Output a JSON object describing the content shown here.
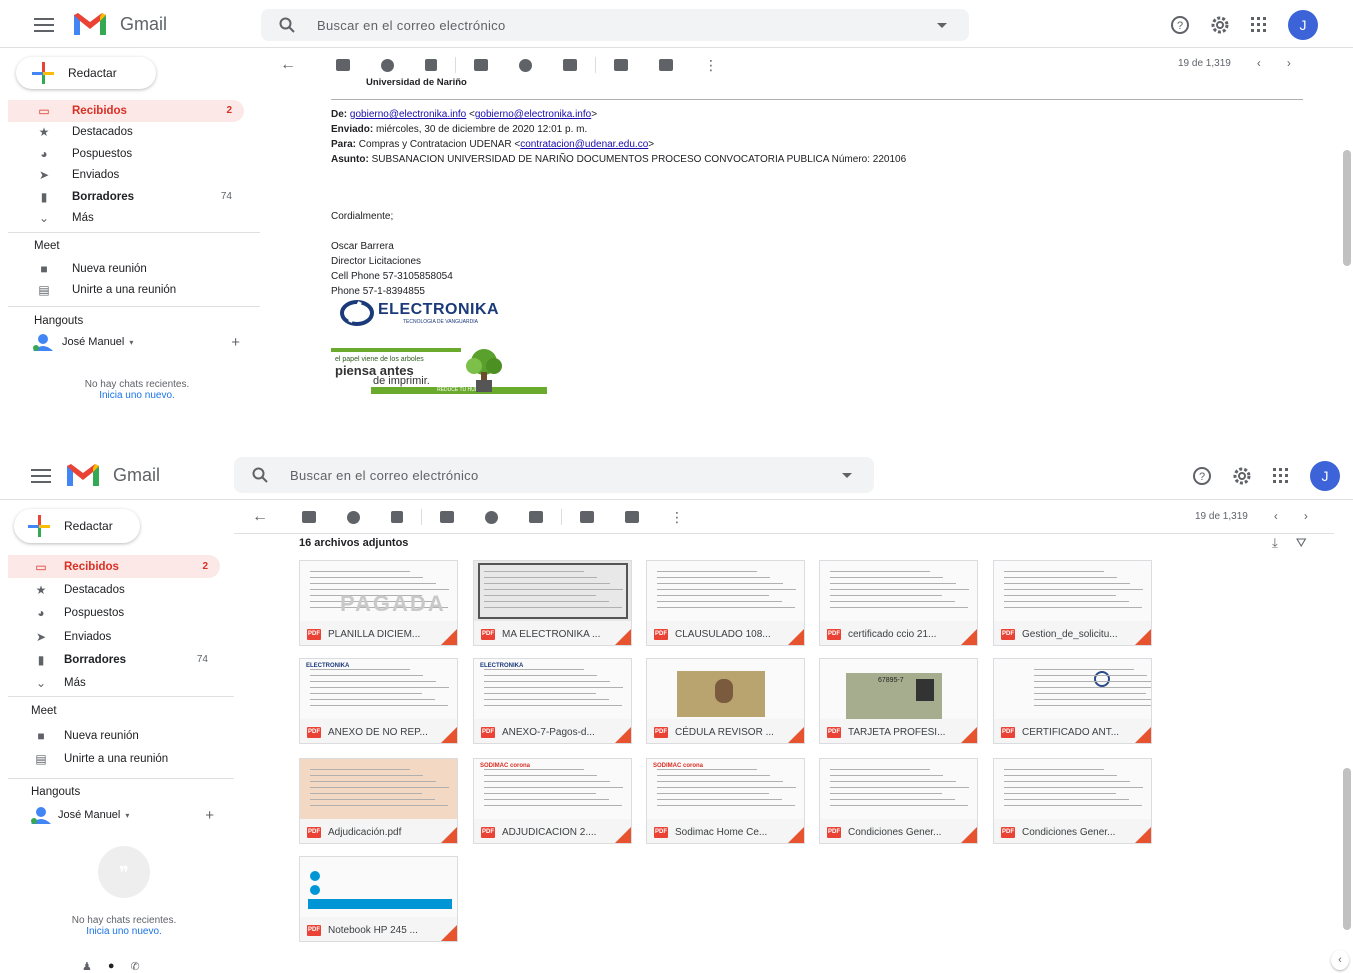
{
  "app": {
    "name": "Gmail"
  },
  "search": {
    "placeholder": "Buscar en el correo electrónico"
  },
  "avatar_letter": "J",
  "compose_label": "Redactar",
  "nav": [
    {
      "label": "Recibidos",
      "count": "2",
      "icon": "inbox-icon"
    },
    {
      "label": "Destacados",
      "count": "",
      "icon": "star-icon"
    },
    {
      "label": "Pospuestos",
      "count": "",
      "icon": "clock-icon"
    },
    {
      "label": "Enviados",
      "count": "",
      "icon": "send-icon"
    },
    {
      "label": "Borradores",
      "count": "74",
      "icon": "draft-icon"
    },
    {
      "label": "Más",
      "count": "",
      "icon": "chevron-down-icon"
    }
  ],
  "meet": {
    "title": "Meet",
    "new_meeting": "Nueva reunión",
    "join": "Unirte a una reunión"
  },
  "hangouts": {
    "title": "Hangouts",
    "user": "José Manuel",
    "no_chats": "No hay chats recientes.",
    "start_new": "Inicia uno nuevo."
  },
  "pager": {
    "text": "19 de 1,319"
  },
  "email": {
    "org_line": "Universidad de Nariño",
    "from_label": "De:",
    "from_addr": "gobierno@electronika.info",
    "from_addr2": "gobierno@electronika.info",
    "sent_label": "Enviado:",
    "sent_value": "miércoles, 30 de diciembre de 2020 12:01 p. m.",
    "to_label": "Para:",
    "to_value": "Compras y Contratacion UDENAR",
    "to_addr": "contratacion@udenar.edu.co",
    "subject_label": "Asunto:",
    "subject_value": "SUBSANACION UNIVERSIDAD DE NARIÑO DOCUMENTOS PROCESO CONVOCATORIA PUBLICA Número: 220106",
    "greeting": "Cordialmente;",
    "sig": [
      "Oscar Barrera",
      "Director Licitaciones",
      "Cell Phone 57-3105858054",
      "Phone 57-1-8394855"
    ],
    "logo_text": "ELECTRONIKA",
    "logo_sub": "TECNOLOGIA DE VANGUARDIA",
    "eco_1": "el papel viene de los arboles",
    "eco_2": "piensa antes",
    "eco_3": "de imprimir.",
    "eco_4": "REDUCE TU HUELLA"
  },
  "attachments": {
    "title": "16 archivos adjuntos",
    "files": [
      "PLANILLA DICIEM...",
      "MA ELECTRONIKA ...",
      "CLAUSULADO 108...",
      "certificado ccio 21...",
      "Gestion_de_solicitu...",
      "ANEXO DE NO REP...",
      "ANEXO-7-Pagos-d...",
      "CÉDULA REVISOR ...",
      "TARJETA PROFESI...",
      "CERTIFICADO ANT...",
      "Adjudicación.pdf",
      "ADJUDICACION 2....",
      "Sodimac Home Ce...",
      "Condiciones Gener...",
      "Condiciones Gener...",
      "Notebook HP 245 ..."
    ],
    "thumb_texts": {
      "pagada": "PAGADA",
      "electronika": "ELECTRONIKA",
      "sodimac": "SODIMAC corona",
      "card": "67895-7"
    }
  },
  "colors": {
    "red": "#d93025",
    "blue": "#1a73e8",
    "accent": "#ea4335"
  }
}
